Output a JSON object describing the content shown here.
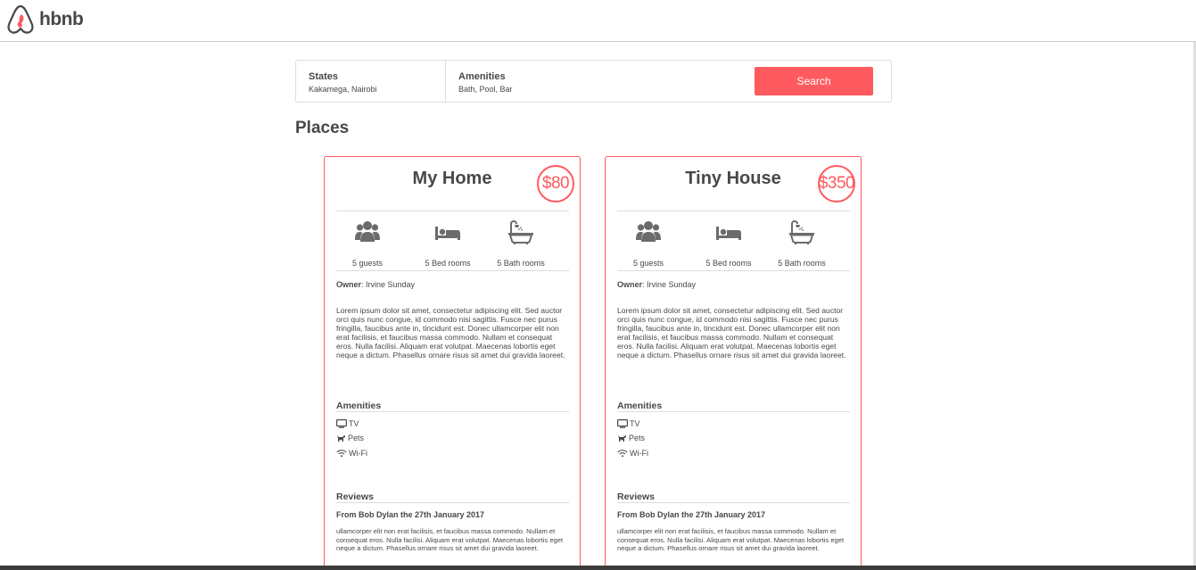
{
  "header": {
    "logo_text": "hbnb",
    "brand_color": "#ff5a5f"
  },
  "filters": {
    "states": {
      "title": "States",
      "value": "Kakamega, Nairobi"
    },
    "amenities": {
      "title": "Amenities",
      "value": "Bath, Pool, Bar"
    },
    "search_label": "Search"
  },
  "places_title": "Places",
  "places": [
    {
      "name": "My Home",
      "price": "$80",
      "guests": "5 guests",
      "bedrooms": "5 Bed rooms",
      "bathrooms": "5 Bath rooms",
      "owner_label": "Owner",
      "owner_name": ": Irvine Sunday",
      "description": "Lorem ipsum dolor sit amet, consectetur adipiscing elit. Sed auctor orci quis nunc congue, id commodo nisi sagittis. Fusce nec purus fringilla, faucibus ante in, tincidunt est. Donec ullamcorper elit non erat facilisis, et faucibus massa commodo. Nullam et consequat eros. Nulla facilisi. Aliquam erat volutpat. Maecenas lobortis eget neque a dictum. Phasellus ornare risus sit amet dui gravida laoreet.",
      "amenities_title": "Amenities",
      "amenities": [
        {
          "icon": "tv-icon",
          "label": "TV"
        },
        {
          "icon": "pets-icon",
          "label": "Pets"
        },
        {
          "icon": "wifi-icon",
          "label": "Wi-Fi"
        }
      ],
      "reviews_title": "Reviews",
      "review_head": "From Bob Dylan the 27th January 2017",
      "review_text": "ullamcorper elit non erat facilisis, et faucibus massa commodo. Nullam et consequat eros. Nulla facilisi. Aliquam erat volutpat. Maecenas lobortis eget neque a dictum. Phasellus ornare risus sit amet dui gravida laoreet."
    },
    {
      "name": "Tiny House",
      "price": "$350",
      "guests": "5 guests",
      "bedrooms": "5 Bed rooms",
      "bathrooms": "5 Bath rooms",
      "owner_label": "Owner",
      "owner_name": ": Irvine Sunday",
      "description": "Lorem ipsum dolor sit amet, consectetur adipiscing elit. Sed auctor orci quis nunc congue, id commodo nisi sagittis. Fusce nec purus fringilla, faucibus ante in, tincidunt est. Donec ullamcorper elit non erat facilisis, et faucibus massa commodo. Nullam et consequat eros. Nulla facilisi. Aliquam erat volutpat. Maecenas lobortis eget neque a dictum. Phasellus ornare risus sit amet dui gravida laoreet.",
      "amenities_title": "Amenities",
      "amenities": [
        {
          "icon": "tv-icon",
          "label": "TV"
        },
        {
          "icon": "pets-icon",
          "label": "Pets"
        },
        {
          "icon": "wifi-icon",
          "label": "Wi-Fi"
        }
      ],
      "reviews_title": "Reviews",
      "review_head": "From Bob Dylan the 27th January 2017",
      "review_text": "ullamcorper elit non erat facilisis, et faucibus massa commodo. Nullam et consequat eros. Nulla facilisi. Aliquam erat volutpat. Maecenas lobortis eget neque a dictum. Phasellus ornare risus sit amet dui gravida laoreet."
    }
  ]
}
